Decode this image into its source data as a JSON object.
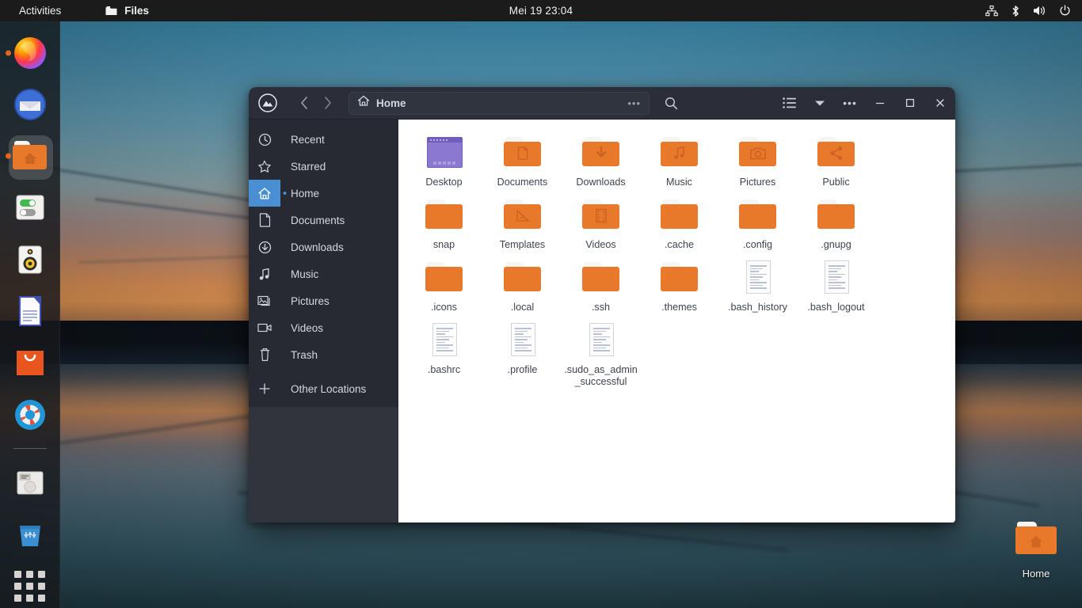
{
  "topbar": {
    "activities": "Activities",
    "app_name": "Files",
    "app_icon": "folder-icon",
    "clock": "Mei 19  23:04",
    "tray": [
      {
        "name": "network-icon",
        "label": "Network"
      },
      {
        "name": "bluetooth-icon",
        "label": "Bluetooth"
      },
      {
        "name": "volume-icon",
        "label": "Volume"
      },
      {
        "name": "power-icon",
        "label": "System menu"
      }
    ]
  },
  "dock": {
    "items": [
      {
        "name": "firefox",
        "label": "Firefox",
        "icon": "firefox-icon",
        "active": true,
        "running": true
      },
      {
        "name": "thunderbird",
        "label": "Thunderbird Mail",
        "icon": "thunderbird-icon",
        "active": false,
        "running": false
      },
      {
        "name": "files",
        "label": "Files",
        "icon": "home-folder-icon",
        "active": true,
        "running": true
      },
      {
        "name": "settings",
        "label": "Settings",
        "icon": "toggle-switch-icon",
        "active": false,
        "running": false
      },
      {
        "name": "rhythmbox",
        "label": "Rhythmbox",
        "icon": "speaker-icon",
        "active": false,
        "running": false
      },
      {
        "name": "writer",
        "label": "LibreOffice Writer",
        "icon": "document-icon",
        "active": false,
        "running": false
      },
      {
        "name": "software",
        "label": "Ubuntu Software",
        "icon": "shopping-bag-icon",
        "active": false,
        "running": false
      },
      {
        "name": "help",
        "label": "Help",
        "icon": "lifebuoy-icon",
        "active": false,
        "running": false
      },
      {
        "name": "disk",
        "label": "Disk drive",
        "icon": "hard-drive-icon",
        "active": false,
        "running": false
      },
      {
        "name": "trash",
        "label": "Trash",
        "icon": "trash-bin-icon",
        "active": false,
        "running": false
      }
    ],
    "show_apps_label": "Show Applications"
  },
  "window": {
    "app_logo": "nautilus-logo-icon",
    "back_label": "Back",
    "forward_label": "Forward",
    "path": {
      "icon": "house-icon",
      "label": "Home",
      "overflow": "•••"
    },
    "search_label": "Search",
    "view_list_label": "View options",
    "view_dropdown_label": "View menu",
    "menu_label": "Main menu",
    "menu_dots": "•••",
    "minimize_label": "Minimize",
    "maximize_label": "Maximize",
    "close_label": "Close"
  },
  "sidebar": {
    "items": [
      {
        "label": "Recent",
        "icon": "clock-icon",
        "selected": false,
        "bullet": false
      },
      {
        "label": "Starred",
        "icon": "star-icon",
        "selected": false,
        "bullet": false
      },
      {
        "label": "Home",
        "icon": "house-icon",
        "selected": true,
        "bullet": true
      },
      {
        "label": "Documents",
        "icon": "document-icon",
        "selected": false,
        "bullet": false
      },
      {
        "label": "Downloads",
        "icon": "download-icon",
        "selected": false,
        "bullet": false
      },
      {
        "label": "Music",
        "icon": "music-note-icon",
        "selected": false,
        "bullet": false
      },
      {
        "label": "Pictures",
        "icon": "image-icon",
        "selected": false,
        "bullet": false
      },
      {
        "label": "Videos",
        "icon": "video-camera-icon",
        "selected": false,
        "bullet": false
      },
      {
        "label": "Trash",
        "icon": "trash-bin-icon",
        "selected": false,
        "bullet": false
      },
      {
        "label": "Other Locations",
        "icon": "plus-icon",
        "selected": false,
        "bullet": false
      }
    ]
  },
  "files": [
    {
      "name": "Desktop",
      "type": "desktop",
      "emblem": "monitor-icon"
    },
    {
      "name": "Documents",
      "type": "folder",
      "emblem": "document-emblem"
    },
    {
      "name": "Downloads",
      "type": "folder",
      "emblem": "download-emblem"
    },
    {
      "name": "Music",
      "type": "folder",
      "emblem": "music-emblem"
    },
    {
      "name": "Pictures",
      "type": "folder",
      "emblem": "camera-emblem"
    },
    {
      "name": "Public",
      "type": "folder",
      "emblem": "share-emblem"
    },
    {
      "name": "snap",
      "type": "folder",
      "emblem": ""
    },
    {
      "name": "Templates",
      "type": "folder",
      "emblem": "ruler-emblem"
    },
    {
      "name": "Videos",
      "type": "folder",
      "emblem": "film-emblem"
    },
    {
      "name": ".cache",
      "type": "folder",
      "emblem": ""
    },
    {
      "name": ".config",
      "type": "folder",
      "emblem": ""
    },
    {
      "name": ".gnupg",
      "type": "folder",
      "emblem": ""
    },
    {
      "name": ".icons",
      "type": "folder",
      "emblem": ""
    },
    {
      "name": ".local",
      "type": "folder",
      "emblem": ""
    },
    {
      "name": ".ssh",
      "type": "folder",
      "emblem": ""
    },
    {
      "name": ".themes",
      "type": "folder",
      "emblem": ""
    },
    {
      "name": ".bash_history",
      "type": "text",
      "emblem": ""
    },
    {
      "name": ".bash_logout",
      "type": "text",
      "emblem": ""
    },
    {
      "name": ".bashrc",
      "type": "text",
      "emblem": ""
    },
    {
      "name": ".profile",
      "type": "text",
      "emblem": ""
    },
    {
      "name": ".sudo_as_admin_successful",
      "type": "text",
      "emblem": ""
    }
  ],
  "desktop_icons": [
    {
      "name": "Home",
      "icon": "home-folder-icon"
    }
  ],
  "colors": {
    "accent_orange": "#e8792b",
    "selection_blue": "#4a8fd4",
    "header_bg": "#2b2e39",
    "sidebar_bg": "#272a33",
    "topbar_bg": "#1b1b1b",
    "content_bg": "#ffffff"
  }
}
